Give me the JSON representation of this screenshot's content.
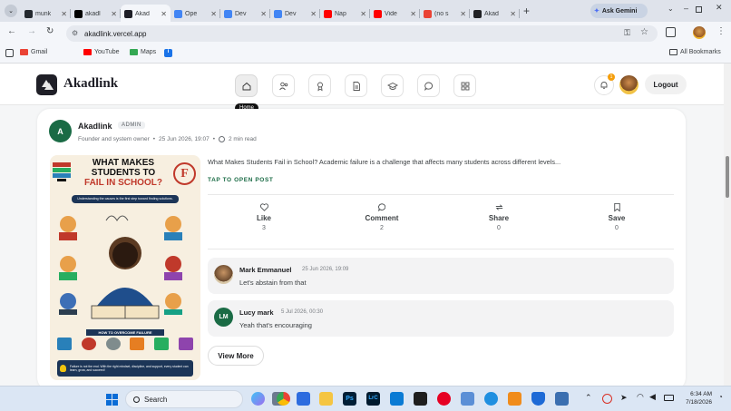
{
  "browser": {
    "tabs": [
      {
        "title": "munk",
        "color": "#24292f",
        "icon": "github-icon"
      },
      {
        "title": "akadl",
        "color": "#000000",
        "icon": "vercel-icon"
      },
      {
        "title": "Akad",
        "color": "#1f1f27",
        "icon": "akadlink-icon",
        "active": true
      },
      {
        "title": "Ope",
        "color": "#4285f4",
        "icon": "d-icon"
      },
      {
        "title": "Dev",
        "color": "#4285f4",
        "icon": "d-icon"
      },
      {
        "title": "Dev",
        "color": "#4285f4",
        "icon": "d-icon"
      },
      {
        "title": "Nap",
        "color": "#ff0000",
        "icon": "youtube-icon"
      },
      {
        "title": "Vide",
        "color": "#ff0000",
        "icon": "youtube-icon"
      },
      {
        "title": "(no s",
        "color": "#ea4335",
        "icon": "gmail-icon"
      },
      {
        "title": "Akad",
        "color": "#202124",
        "icon": "akadlink-icon"
      }
    ],
    "gemini_label": "Ask Gemini",
    "url": "akadlink.vercel.app",
    "bookmarks": [
      {
        "label": "Gmail",
        "color": "#ea4335"
      },
      {
        "label": "YouTube",
        "color": "#ff0000"
      },
      {
        "label": "Maps",
        "color": "#34a853"
      }
    ],
    "all_bookmarks": "All Bookmarks"
  },
  "app": {
    "brand": "Akadlink",
    "nav": [
      "home-icon",
      "people-icon",
      "award-icon",
      "document-icon",
      "graduation-icon",
      "chat-icon",
      "apps-icon"
    ],
    "tooltip": "Home",
    "notif_count": "1",
    "logout": "Logout",
    "accent": "#1a6b45"
  },
  "post": {
    "author": "Akadlink",
    "author_initial": "A",
    "badge": "ADMIN",
    "role": "Founder and system owner",
    "date": "25 Jun 2026, 19:07",
    "read_time": "2 min read",
    "excerpt": "What Makes Students Fail in School? Academic failure is a challenge that affects many students across different levels...",
    "open_cta": "TAP TO OPEN POST",
    "poster": {
      "title1": "WHAT MAKES",
      "title2": "STUDENTS TO",
      "title3": "FAIL IN SCHOOL?",
      "grade": "F",
      "subtitle": "Understanding the causes is the first step toward finding solutions.",
      "how_to": "HOW TO OVERCOME FAILURE",
      "footer": "Failure is not the end. With the right mindset, discipline, and support, every student can learn, grow, and succeed!"
    },
    "actions": [
      {
        "label": "Like",
        "count": "3",
        "icon": "heart-icon"
      },
      {
        "label": "Comment",
        "count": "2",
        "icon": "comment-icon"
      },
      {
        "label": "Share",
        "count": "0",
        "icon": "share-icon"
      },
      {
        "label": "Save",
        "count": "0",
        "icon": "bookmark-icon"
      }
    ],
    "comments": [
      {
        "name": "Mark Emmanuel",
        "time": "25 Jun 2026, 19:09",
        "text": "Let's abstain from that",
        "initials": ""
      },
      {
        "name": "Lucy mark",
        "time": "5 Jul 2026, 00:30",
        "text": "Yeah that's encouraging",
        "initials": "LM"
      }
    ],
    "view_more": "View More"
  },
  "taskbar": {
    "search": "Search",
    "time": "6:34 AM",
    "date": "7/18/2026"
  }
}
